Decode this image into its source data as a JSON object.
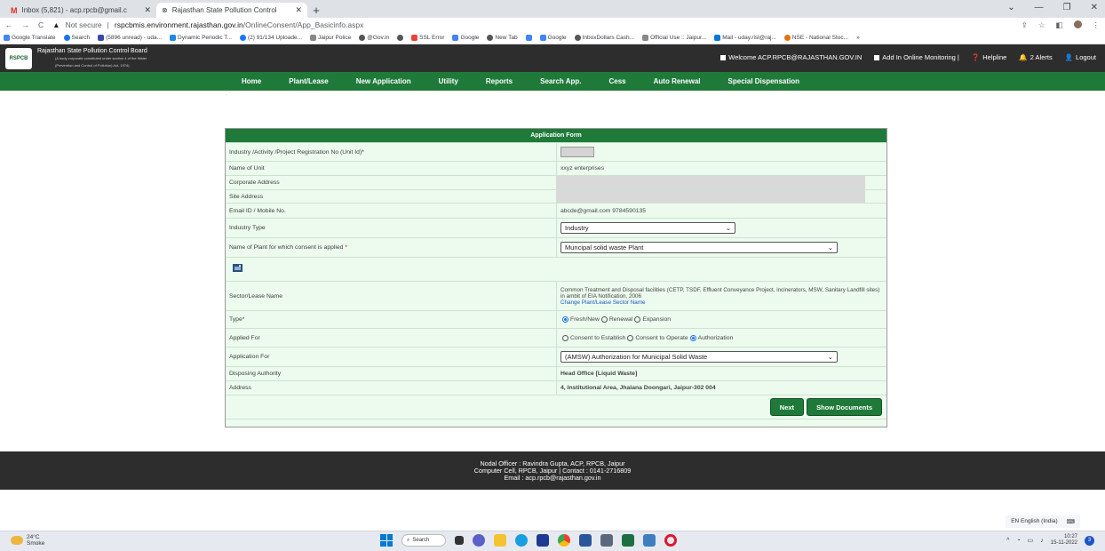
{
  "browser": {
    "tabs": [
      {
        "label": "Inbox (5,821) - acp.rpcb@gmail.c",
        "icon_color": "#d93025"
      },
      {
        "label": "Rajasthan State Pollution Control",
        "icon_color": "#555555"
      }
    ],
    "url_security": "Not secure",
    "url_host": "rspcbmis.environment.rajasthan.gov.in",
    "url_path": "/OnlineConsent/App_Basicinfo.aspx",
    "bookmarks": [
      "Google Translate",
      "Search",
      "(5896 unread) - uda...",
      "Dynamic Periodic T...",
      "(2) 91/134 Uploade...",
      "Jaipur Police",
      "@Gov.in",
      "SSL Error",
      "Google",
      "New Tab",
      "Google",
      "InboxDollars Cash...",
      "Official Use :: Jaipur...",
      "Mail - uday.risl@raj...",
      "NSE - National Stoc..."
    ]
  },
  "header": {
    "logo_text": "RSPCB",
    "org_name": "Rajasthan State Pollution Control Board",
    "org_sub1": "(A body corporate constituted under section 4 of the Water",
    "org_sub2": "(Prevention and Control of Pollution) Act, 1974)",
    "welcome": "Welcome ACP.RPCB@RAJASTHAN.GOV.IN",
    "monitoring": "Add In Online Monitoring |",
    "helpline": "Helpline",
    "alerts": "2 Alerts",
    "logout": "Logout"
  },
  "nav": [
    "Home",
    "Plant/Lease",
    "New Application",
    "Utility",
    "Reports",
    "Search App.",
    "Cess",
    "Auto Renewal",
    "Special Dispensation"
  ],
  "form": {
    "title": "Application Form",
    "fields": {
      "reg_no_label": "Industry /Activity /Project Registration No (Unit Id)*",
      "unit_name_label": "Name of Unit",
      "unit_name_value": "xxyz enterprises",
      "corp_addr_label": "Corporate Address",
      "site_addr_label": "Site Address",
      "email_label": "Email ID / Mobile No.",
      "email_value": "abcde@gmail.com 9784590135",
      "industry_type_label": "Industry Type",
      "industry_type_value": "Industry",
      "plant_label": "Name of Plant for which consent is applied",
      "plant_req": "*",
      "plant_value": "Muncipal solid waste Plant",
      "sector_label": "Sector/Lease Name",
      "sector_value": "Common Treatment and Disposal facilities (CETP, TSDF, Effluent Conveyance Project, incinerators, MSW, Sanitary Landfill sites) in ambit of EIA Notification, 2006",
      "sector_link": "Change Plant/Lease Sector Name",
      "type_label": "Type*",
      "type_options": [
        "Fresh/New",
        "Renewal",
        "Expansion"
      ],
      "applied_for_label": "Applied For",
      "applied_for_options": [
        "Consent to Establish",
        "Consent to Operate",
        "Authorization"
      ],
      "application_for_label": "Application For",
      "application_for_value": "(AMSW) Authorization for Municipal Solid Waste",
      "disposing_label": "Disposing Authority",
      "disposing_value": "Head Office [Liquid Waste]",
      "address_label": "Address",
      "address_value": "4, Institutional Area, Jhalana Doongari, Jaipur-302 004"
    },
    "next_button": "Next",
    "show_docs_button": "Show Documents"
  },
  "footer": {
    "line1": "Nodal Officer : Ravindra Gupta, ACP, RPCB, Jaipur",
    "line2": "Computer Cell, RPCB, Jaipur | Contact : 0141-2716809",
    "line3": "Email : acp.rpcb@rajasthan.gov.in"
  },
  "taskbar": {
    "temp": "24°C",
    "weather": "Smoke",
    "search": "Search",
    "language": "EN English (India)",
    "time": "10:27",
    "date": "15-11-2022",
    "notif_count": "3"
  },
  "colors": {
    "green": "#1f7a3a",
    "dark": "#2d2d2d",
    "row_bg": "#ecfbee"
  }
}
